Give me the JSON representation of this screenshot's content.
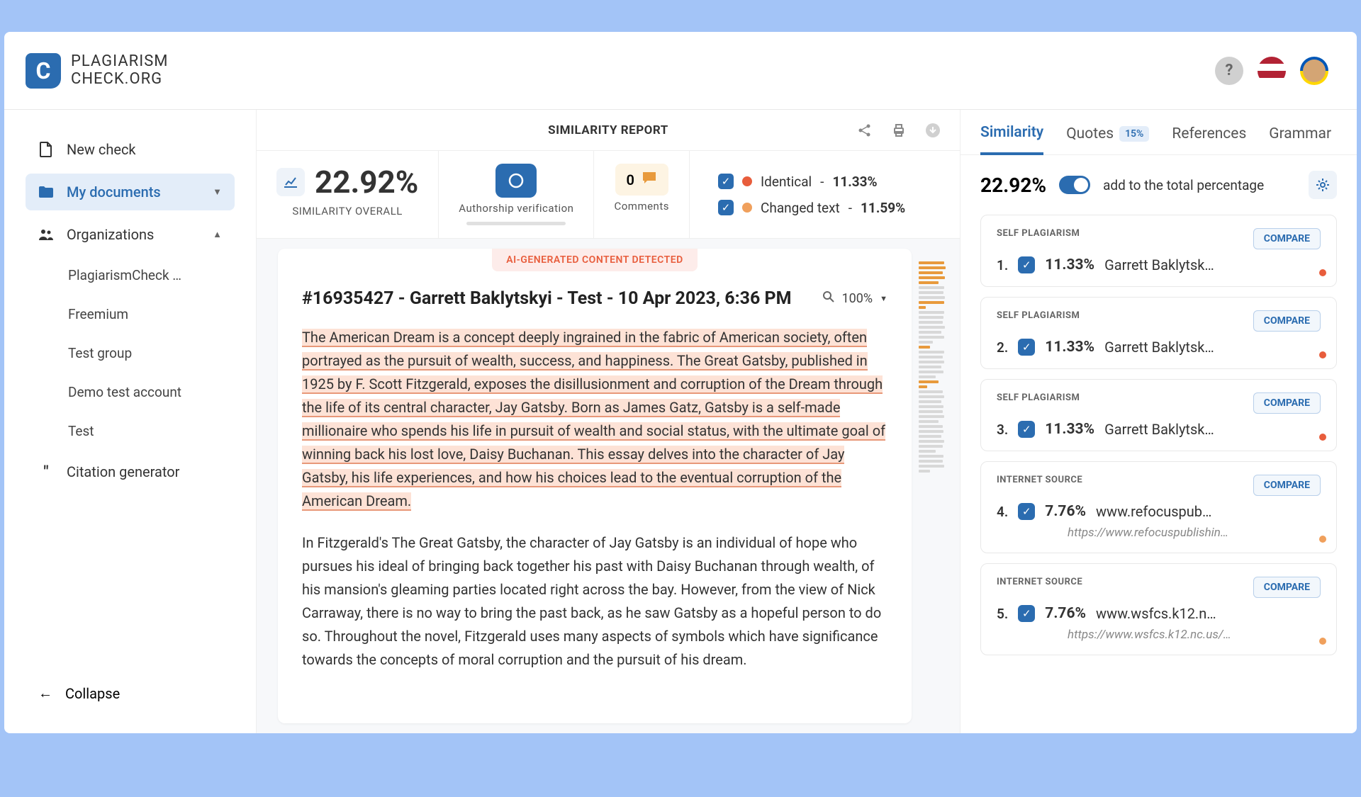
{
  "brand": {
    "line1": "PLAGIARISM",
    "line2": "CHECK.ORG"
  },
  "sidebar": {
    "new_check": "New check",
    "my_documents": "My documents",
    "organizations": "Organizations",
    "orgs": [
      "PlagiarismCheck …",
      "Freemium",
      "Test group",
      "Demo test account",
      "Test"
    ],
    "citation": "Citation generator",
    "collapse": "Collapse"
  },
  "report": {
    "title": "SIMILARITY REPORT",
    "overall_pct": "22.92%",
    "overall_label": "SIMILARITY OVERALL",
    "auth_label": "Authorship verification",
    "comments_count": "0",
    "comments_label": "Comments",
    "identical_label": "Identical",
    "identical_pct": "11.33%",
    "changed_label": "Changed text",
    "changed_pct": "11.59%",
    "ai_banner": "AI-GENERATED CONTENT DETECTED",
    "doc_title": "#16935427 - Garrett Baklytskyi - Test - 10 Apr 2023, 6:36 PM",
    "zoom": "100%",
    "para1": "The American Dream is a concept deeply ingrained in the fabric of American society, often portrayed as the pursuit of wealth, success, and happiness. The Great Gatsby, published in 1925 by F. Scott Fitzgerald, exposes the disillusionment and corruption of the Dream through the life of its central character, Jay Gatsby. Born as James Gatz, Gatsby is a self-made millionaire who spends his life in pursuit of wealth and social status, with the ultimate goal of winning back his lost love, Daisy Buchanan. This essay delves into the character of Jay Gatsby, his life experiences, and how his choices lead to the eventual corruption of the American Dream.",
    "para2": "In Fitzgerald's The Great Gatsby, the character of Jay Gatsby is an individual of hope who pursues his ideal of bringing back together his past with Daisy Buchanan through wealth, of his mansion's gleaming parties located right across the bay. However, from the view of Nick Carraway, there is no way to bring the past back, as he saw Gatsby as a hopeful person to do so. Throughout the novel, Fitzgerald uses many aspects of symbols which have significance towards the concepts of moral corruption and the pursuit of his dream."
  },
  "tabs": {
    "similarity": "Similarity",
    "quotes": "Quotes",
    "quotes_badge": "15%",
    "references": "References",
    "grammar": "Grammar"
  },
  "summary": {
    "pct": "22.92%",
    "text": "add to the total percentage"
  },
  "sources": [
    {
      "num": "1.",
      "tag": "SELF PLAGIARISM",
      "pct": "11.33%",
      "name": "Garrett Baklytsk…",
      "url": "",
      "dot": "red"
    },
    {
      "num": "2.",
      "tag": "SELF PLAGIARISM",
      "pct": "11.33%",
      "name": "Garrett Baklytsk…",
      "url": "",
      "dot": "red"
    },
    {
      "num": "3.",
      "tag": "SELF PLAGIARISM",
      "pct": "11.33%",
      "name": "Garrett Baklytsk…",
      "url": "",
      "dot": "red"
    },
    {
      "num": "4.",
      "tag": "INTERNET SOURCE",
      "pct": "7.76%",
      "name": "www.refocuspub…",
      "url": "https://www.refocuspublishin…",
      "dot": "orange"
    },
    {
      "num": "5.",
      "tag": "INTERNET SOURCE",
      "pct": "7.76%",
      "name": "www.wsfcs.k12.n…",
      "url": "https://www.wsfcs.k12.nc.us/…",
      "dot": "orange"
    }
  ],
  "compare_label": "COMPARE"
}
